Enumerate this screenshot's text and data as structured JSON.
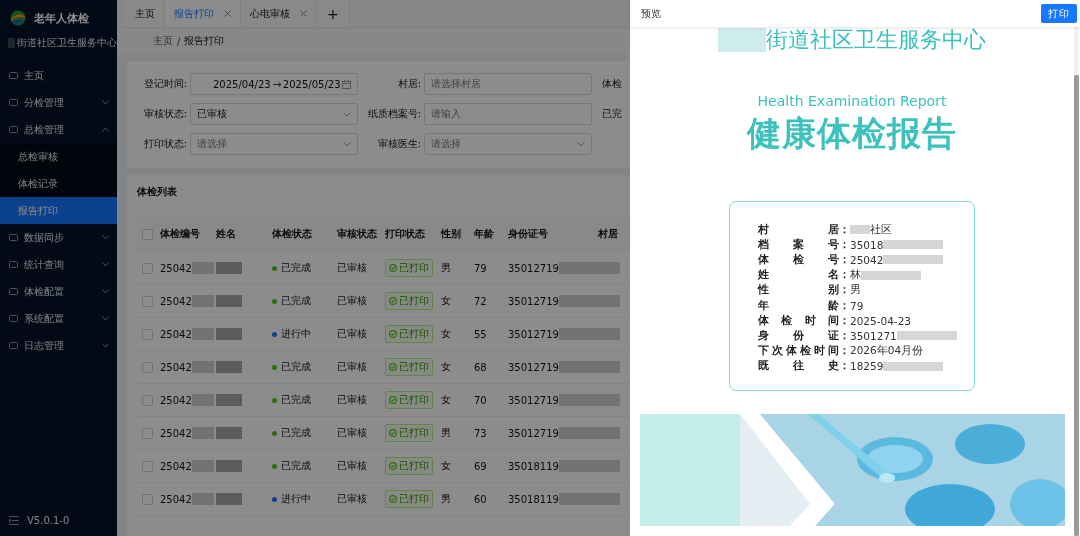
{
  "app": {
    "title": "老年人体检",
    "org_suffix": "街道社区卫生服务中心",
    "version": "V5.0.1-0"
  },
  "sidebar": {
    "items": [
      {
        "label": "主页",
        "selected": false
      },
      {
        "label": "分检管理",
        "expanded": false,
        "selected": false
      },
      {
        "label": "总检管理",
        "expanded": true,
        "selected": false,
        "children": [
          {
            "label": "总检审核",
            "selected": false
          },
          {
            "label": "体检记录",
            "selected": false
          },
          {
            "label": "报告打印",
            "selected": true
          }
        ]
      },
      {
        "label": "数据同步",
        "expanded": false,
        "selected": false
      },
      {
        "label": "统计查询",
        "expanded": false,
        "selected": false
      },
      {
        "label": "体检配置",
        "expanded": false,
        "selected": false
      },
      {
        "label": "系统配置",
        "expanded": false,
        "selected": false
      },
      {
        "label": "日志管理",
        "expanded": false,
        "selected": false
      }
    ]
  },
  "tabs": [
    {
      "label": "主页",
      "selected": false,
      "closable": false
    },
    {
      "label": "报告打印",
      "selected": true,
      "closable": true
    },
    {
      "label": "心电审核",
      "selected": false,
      "closable": true
    },
    {
      "label": "+",
      "kind": "add"
    }
  ],
  "breadcrumb": [
    "主页",
    "/",
    "报告打印"
  ],
  "filters": [
    {
      "label": "登记时间:",
      "kind": "daterange",
      "start": "2025/04/23",
      "sep": "→",
      "end": "2025/05/23"
    },
    {
      "label": "村居:",
      "kind": "input",
      "placeholder": "请选择村居"
    },
    {
      "label": "体检",
      "kind": "cut"
    },
    {
      "label": "审核状态:",
      "kind": "select",
      "value": "已审核"
    },
    {
      "label": "纸质档案号:",
      "kind": "input",
      "placeholder": "请输入"
    },
    {
      "label": "已完",
      "kind": "cut"
    },
    {
      "label": "打印状态:",
      "kind": "select",
      "placeholder": "请选择"
    },
    {
      "label": "审核医生:",
      "kind": "select",
      "placeholder": "请选择"
    }
  ],
  "table": {
    "title": "体检列表",
    "header_checked": false,
    "columns": [
      "体检编号",
      "姓名",
      "体检状态",
      "审核状态",
      "打印状态",
      "性别",
      "年龄",
      "身份证号",
      "村居"
    ],
    "rows": [
      {
        "checked": false,
        "id": "25042",
        "status": "已完成",
        "color": "#2d6c0e",
        "review": "已审核",
        "print": "已打印",
        "gender": "男",
        "age": "79",
        "idno": "35012719"
      },
      {
        "checked": false,
        "id": "25042",
        "status": "已完成",
        "color": "#2d6c0e",
        "review": "已审核",
        "print": "已打印",
        "gender": "女",
        "age": "72",
        "idno": "35012719"
      },
      {
        "checked": false,
        "id": "25042",
        "status": "进行中",
        "color": "#0c418c",
        "review": "已审核",
        "print": "已打印",
        "gender": "女",
        "age": "55",
        "idno": "35012719"
      },
      {
        "checked": false,
        "id": "25042",
        "status": "已完成",
        "color": "#2d6c0e",
        "review": "已审核",
        "print": "已打印",
        "gender": "女",
        "age": "68",
        "idno": "35012719"
      },
      {
        "checked": false,
        "id": "25042",
        "status": "已完成",
        "color": "#2d6c0e",
        "review": "已审核",
        "print": "已打印",
        "gender": "女",
        "age": "70",
        "idno": "35012719"
      },
      {
        "checked": false,
        "id": "25042",
        "status": "已完成",
        "color": "#2d6c0e",
        "review": "已审核",
        "print": "已打印",
        "gender": "男",
        "age": "73",
        "idno": "35012719"
      },
      {
        "checked": false,
        "id": "25042",
        "status": "已完成",
        "color": "#2d6c0e",
        "review": "已审核",
        "print": "已打印",
        "gender": "女",
        "age": "69",
        "idno": "35018119"
      },
      {
        "checked": false,
        "id": "25042",
        "status": "进行中",
        "color": "#0c418c",
        "review": "已审核",
        "print": "已打印",
        "gender": "男",
        "age": "60",
        "idno": "35018119"
      }
    ]
  },
  "drawer": {
    "title": "预览",
    "print_button": "打印",
    "report": {
      "org_suffix": "街道社区卫生服务中心",
      "subtitle": "Health Examination Report",
      "title": "健康体检报告",
      "info": [
        {
          "label": "村居",
          "colon": "：",
          "value": "社区",
          "redacted_before": true,
          "redacted_after": false
        },
        {
          "label": "档案号",
          "colon": "：",
          "value": "35018",
          "redacted_before": false,
          "redacted_after": true
        },
        {
          "label": "体检号",
          "colon": "：",
          "value": "25042",
          "redacted_before": false,
          "redacted_after": true
        },
        {
          "label": "姓名",
          "colon": "：",
          "value": "林",
          "redacted_before": false,
          "redacted_after": true
        },
        {
          "label": "性别",
          "colon": "：",
          "value": "男",
          "redacted_before": false,
          "redacted_after": false
        },
        {
          "label": "年龄",
          "colon": "：",
          "value": "79",
          "redacted_before": false,
          "redacted_after": false
        },
        {
          "label": "体检时间",
          "colon": "：",
          "value": "2025-04-23",
          "redacted_before": false,
          "redacted_after": false
        },
        {
          "label": "身份证",
          "colon": "：",
          "value": "3501271",
          "redacted_before": false,
          "redacted_after": true
        },
        {
          "label": "下次体检时间",
          "colon": "：",
          "value": "2026年04月份",
          "redacted_before": false,
          "redacted_after": false
        },
        {
          "label": "既往史",
          "colon": "：",
          "value": "18259",
          "redacted_before": false,
          "redacted_after": true
        }
      ]
    }
  }
}
